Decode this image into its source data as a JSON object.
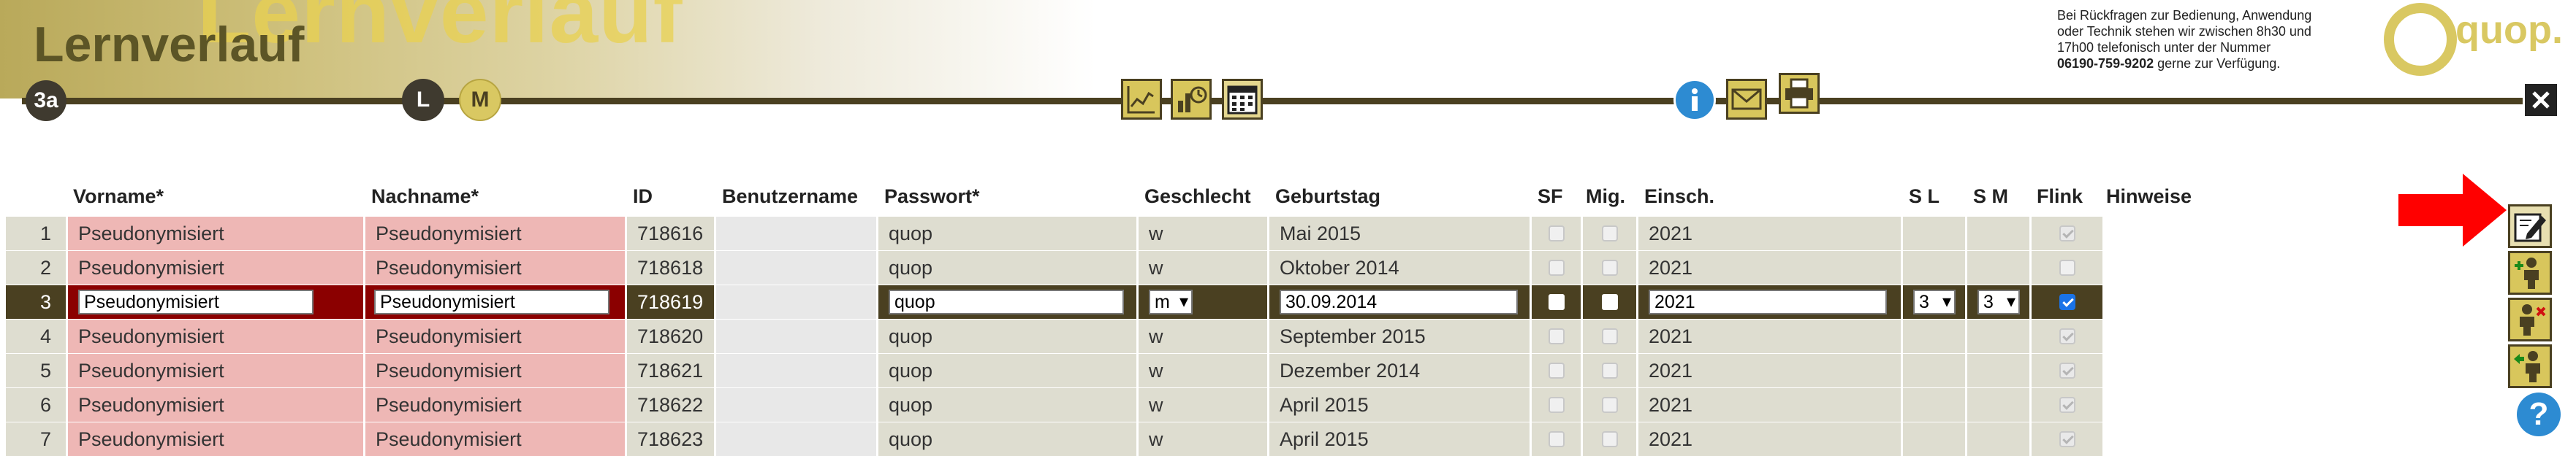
{
  "header": {
    "watermark": "Lernverlauf",
    "title": "Lernverlauf",
    "class_badge": "3a",
    "mode_L": "L",
    "mode_M": "M",
    "help_text_lines": [
      "Bei Rückfragen zur Bedienung, Anwendung",
      "oder Technik stehen wir zwischen 8h30 und",
      "17h00 telefonisch unter der Nummer"
    ],
    "help_phone": "06190-759-9202",
    "help_suffix": " gerne zur Verfügung.",
    "logo_text": "quop."
  },
  "icons": {
    "header_tools": [
      "chart-icon",
      "statistics-icon",
      "calendar-icon",
      "info-icon",
      "mail-icon",
      "print-icon",
      "close-icon"
    ],
    "side_tools": [
      "edit-icon",
      "add-student-icon",
      "remove-student-icon",
      "move-student-icon",
      "help-icon"
    ]
  },
  "colors": {
    "accent_dark": "#4a4021",
    "accent_gold": "#d8c65c",
    "row_bg": "#deddd0",
    "required_pink": "#eeb7b5",
    "selected_red": "#8b0000",
    "arrow_red": "#ff0000",
    "info_blue": "#2d8bd2"
  },
  "table": {
    "headers": {
      "vorname": "Vorname*",
      "nachname": "Nachname*",
      "id": "ID",
      "benutzername": "Benutzername",
      "passwort": "Passwort*",
      "geschlecht": "Geschlecht",
      "geburtstag": "Geburtstag",
      "sf": "SF",
      "mig": "Mig.",
      "einsch": "Einsch.",
      "sl": "S L",
      "sm": "S M",
      "flink": "Flink",
      "hinweise": "Hinweise"
    },
    "rows": [
      {
        "nr": "1",
        "vorname": "Pseudonymisiert",
        "nachname": "Pseudonymisiert",
        "id": "718616",
        "benutzername": "",
        "passwort": "quop",
        "geschlecht": "w",
        "geburtstag": "Mai 2015",
        "sf": false,
        "mig": false,
        "einsch": "2021",
        "sl": "",
        "sm": "",
        "flink": true
      },
      {
        "nr": "2",
        "vorname": "Pseudonymisiert",
        "nachname": "Pseudonymisiert",
        "id": "718618",
        "benutzername": "",
        "passwort": "quop",
        "geschlecht": "w",
        "geburtstag": "Oktober 2014",
        "sf": false,
        "mig": false,
        "einsch": "2021",
        "sl": "",
        "sm": "",
        "flink": false
      },
      {
        "nr": "3",
        "vorname": "Pseudonymisiert",
        "nachname": "Pseudonymisiert",
        "id": "718619",
        "benutzername": "",
        "passwort": "quop",
        "geschlecht": "m",
        "geburtstag": "30.09.2014",
        "sf": false,
        "mig": false,
        "einsch": "2021",
        "sl": "3",
        "sm": "3",
        "flink": true,
        "selected": true
      },
      {
        "nr": "4",
        "vorname": "Pseudonymisiert",
        "nachname": "Pseudonymisiert",
        "id": "718620",
        "benutzername": "",
        "passwort": "quop",
        "geschlecht": "w",
        "geburtstag": "September 2015",
        "sf": false,
        "mig": false,
        "einsch": "2021",
        "sl": "",
        "sm": "",
        "flink": true
      },
      {
        "nr": "5",
        "vorname": "Pseudonymisiert",
        "nachname": "Pseudonymisiert",
        "id": "718621",
        "benutzername": "",
        "passwort": "quop",
        "geschlecht": "w",
        "geburtstag": "Dezember 2014",
        "sf": false,
        "mig": false,
        "einsch": "2021",
        "sl": "",
        "sm": "",
        "flink": true
      },
      {
        "nr": "6",
        "vorname": "Pseudonymisiert",
        "nachname": "Pseudonymisiert",
        "id": "718622",
        "benutzername": "",
        "passwort": "quop",
        "geschlecht": "w",
        "geburtstag": "April 2015",
        "sf": false,
        "mig": false,
        "einsch": "2021",
        "sl": "",
        "sm": "",
        "flink": true
      },
      {
        "nr": "7",
        "vorname": "Pseudonymisiert",
        "nachname": "Pseudonymisiert",
        "id": "718623",
        "benutzername": "",
        "passwort": "quop",
        "geschlecht": "w",
        "geburtstag": "April 2015",
        "sf": false,
        "mig": false,
        "einsch": "2021",
        "sl": "",
        "sm": "",
        "flink": true
      }
    ]
  }
}
